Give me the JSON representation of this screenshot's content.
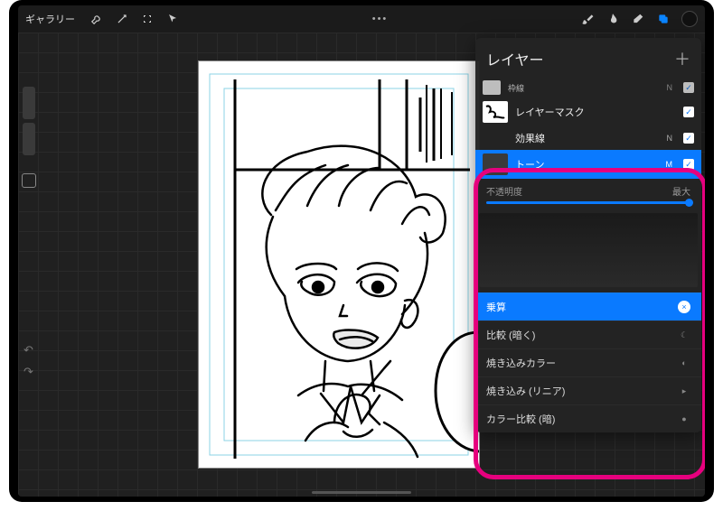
{
  "toolbar": {
    "gallery_label": "ギャラリー",
    "menu_glyph": "•••"
  },
  "layers_panel": {
    "title": "レイヤー",
    "layers": [
      {
        "name": "枠線",
        "blend": "N",
        "checked": true,
        "small": true
      },
      {
        "name": "レイヤーマスク",
        "blend": "",
        "checked": true
      },
      {
        "name": "効果線",
        "blend": "N",
        "checked": true
      },
      {
        "name": "トーン",
        "blend": "M",
        "checked": true,
        "selected": true
      }
    ],
    "opacity": {
      "label": "不透明度",
      "value_label": "最大"
    },
    "blend_modes": [
      {
        "name": "乗算",
        "selected": true,
        "icon": "×"
      },
      {
        "name": "比較 (暗く)",
        "icon": "☾"
      },
      {
        "name": "焼き込みカラー",
        "icon": "◐"
      },
      {
        "name": "焼き込み (リニア)",
        "icon": "▸"
      },
      {
        "name": "カラー比較 (暗)",
        "icon": "●"
      }
    ]
  }
}
